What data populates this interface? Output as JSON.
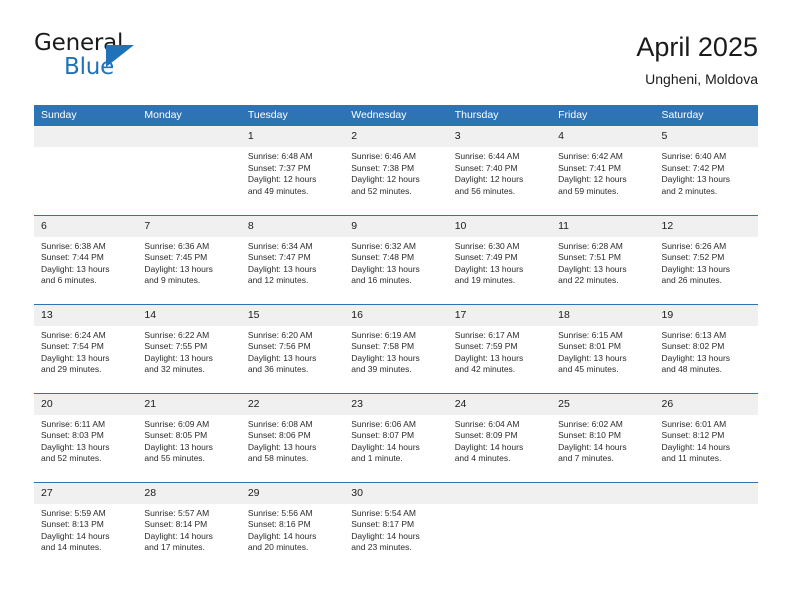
{
  "brand": {
    "line1": "General",
    "line2": "Blue",
    "logo_icon": "blue-triangle-logo",
    "accent_color": "#1f72b8"
  },
  "header": {
    "title": "April 2025",
    "subtitle": "Ungheni, Moldova"
  },
  "theme": {
    "header_bg": "#2e74b5",
    "daynum_bg": "#f0f0f0",
    "text": "#1b1b1b"
  },
  "calendar": {
    "weekday_headers": [
      "Sunday",
      "Monday",
      "Tuesday",
      "Wednesday",
      "Thursday",
      "Friday",
      "Saturday"
    ],
    "weeks": [
      [
        {
          "day": "",
          "sunrise": "",
          "sunset": "",
          "daylight_1": "",
          "daylight_2": ""
        },
        {
          "day": "",
          "sunrise": "",
          "sunset": "",
          "daylight_1": "",
          "daylight_2": ""
        },
        {
          "day": "1",
          "sunrise": "Sunrise: 6:48 AM",
          "sunset": "Sunset: 7:37 PM",
          "daylight_1": "Daylight: 12 hours",
          "daylight_2": "and 49 minutes."
        },
        {
          "day": "2",
          "sunrise": "Sunrise: 6:46 AM",
          "sunset": "Sunset: 7:38 PM",
          "daylight_1": "Daylight: 12 hours",
          "daylight_2": "and 52 minutes."
        },
        {
          "day": "3",
          "sunrise": "Sunrise: 6:44 AM",
          "sunset": "Sunset: 7:40 PM",
          "daylight_1": "Daylight: 12 hours",
          "daylight_2": "and 56 minutes."
        },
        {
          "day": "4",
          "sunrise": "Sunrise: 6:42 AM",
          "sunset": "Sunset: 7:41 PM",
          "daylight_1": "Daylight: 12 hours",
          "daylight_2": "and 59 minutes."
        },
        {
          "day": "5",
          "sunrise": "Sunrise: 6:40 AM",
          "sunset": "Sunset: 7:42 PM",
          "daylight_1": "Daylight: 13 hours",
          "daylight_2": "and 2 minutes."
        }
      ],
      [
        {
          "day": "6",
          "sunrise": "Sunrise: 6:38 AM",
          "sunset": "Sunset: 7:44 PM",
          "daylight_1": "Daylight: 13 hours",
          "daylight_2": "and 6 minutes."
        },
        {
          "day": "7",
          "sunrise": "Sunrise: 6:36 AM",
          "sunset": "Sunset: 7:45 PM",
          "daylight_1": "Daylight: 13 hours",
          "daylight_2": "and 9 minutes."
        },
        {
          "day": "8",
          "sunrise": "Sunrise: 6:34 AM",
          "sunset": "Sunset: 7:47 PM",
          "daylight_1": "Daylight: 13 hours",
          "daylight_2": "and 12 minutes."
        },
        {
          "day": "9",
          "sunrise": "Sunrise: 6:32 AM",
          "sunset": "Sunset: 7:48 PM",
          "daylight_1": "Daylight: 13 hours",
          "daylight_2": "and 16 minutes."
        },
        {
          "day": "10",
          "sunrise": "Sunrise: 6:30 AM",
          "sunset": "Sunset: 7:49 PM",
          "daylight_1": "Daylight: 13 hours",
          "daylight_2": "and 19 minutes."
        },
        {
          "day": "11",
          "sunrise": "Sunrise: 6:28 AM",
          "sunset": "Sunset: 7:51 PM",
          "daylight_1": "Daylight: 13 hours",
          "daylight_2": "and 22 minutes."
        },
        {
          "day": "12",
          "sunrise": "Sunrise: 6:26 AM",
          "sunset": "Sunset: 7:52 PM",
          "daylight_1": "Daylight: 13 hours",
          "daylight_2": "and 26 minutes."
        }
      ],
      [
        {
          "day": "13",
          "sunrise": "Sunrise: 6:24 AM",
          "sunset": "Sunset: 7:54 PM",
          "daylight_1": "Daylight: 13 hours",
          "daylight_2": "and 29 minutes."
        },
        {
          "day": "14",
          "sunrise": "Sunrise: 6:22 AM",
          "sunset": "Sunset: 7:55 PM",
          "daylight_1": "Daylight: 13 hours",
          "daylight_2": "and 32 minutes."
        },
        {
          "day": "15",
          "sunrise": "Sunrise: 6:20 AM",
          "sunset": "Sunset: 7:56 PM",
          "daylight_1": "Daylight: 13 hours",
          "daylight_2": "and 36 minutes."
        },
        {
          "day": "16",
          "sunrise": "Sunrise: 6:19 AM",
          "sunset": "Sunset: 7:58 PM",
          "daylight_1": "Daylight: 13 hours",
          "daylight_2": "and 39 minutes."
        },
        {
          "day": "17",
          "sunrise": "Sunrise: 6:17 AM",
          "sunset": "Sunset: 7:59 PM",
          "daylight_1": "Daylight: 13 hours",
          "daylight_2": "and 42 minutes."
        },
        {
          "day": "18",
          "sunrise": "Sunrise: 6:15 AM",
          "sunset": "Sunset: 8:01 PM",
          "daylight_1": "Daylight: 13 hours",
          "daylight_2": "and 45 minutes."
        },
        {
          "day": "19",
          "sunrise": "Sunrise: 6:13 AM",
          "sunset": "Sunset: 8:02 PM",
          "daylight_1": "Daylight: 13 hours",
          "daylight_2": "and 48 minutes."
        }
      ],
      [
        {
          "day": "20",
          "sunrise": "Sunrise: 6:11 AM",
          "sunset": "Sunset: 8:03 PM",
          "daylight_1": "Daylight: 13 hours",
          "daylight_2": "and 52 minutes."
        },
        {
          "day": "21",
          "sunrise": "Sunrise: 6:09 AM",
          "sunset": "Sunset: 8:05 PM",
          "daylight_1": "Daylight: 13 hours",
          "daylight_2": "and 55 minutes."
        },
        {
          "day": "22",
          "sunrise": "Sunrise: 6:08 AM",
          "sunset": "Sunset: 8:06 PM",
          "daylight_1": "Daylight: 13 hours",
          "daylight_2": "and 58 minutes."
        },
        {
          "day": "23",
          "sunrise": "Sunrise: 6:06 AM",
          "sunset": "Sunset: 8:07 PM",
          "daylight_1": "Daylight: 14 hours",
          "daylight_2": "and 1 minute."
        },
        {
          "day": "24",
          "sunrise": "Sunrise: 6:04 AM",
          "sunset": "Sunset: 8:09 PM",
          "daylight_1": "Daylight: 14 hours",
          "daylight_2": "and 4 minutes."
        },
        {
          "day": "25",
          "sunrise": "Sunrise: 6:02 AM",
          "sunset": "Sunset: 8:10 PM",
          "daylight_1": "Daylight: 14 hours",
          "daylight_2": "and 7 minutes."
        },
        {
          "day": "26",
          "sunrise": "Sunrise: 6:01 AM",
          "sunset": "Sunset: 8:12 PM",
          "daylight_1": "Daylight: 14 hours",
          "daylight_2": "and 11 minutes."
        }
      ],
      [
        {
          "day": "27",
          "sunrise": "Sunrise: 5:59 AM",
          "sunset": "Sunset: 8:13 PM",
          "daylight_1": "Daylight: 14 hours",
          "daylight_2": "and 14 minutes."
        },
        {
          "day": "28",
          "sunrise": "Sunrise: 5:57 AM",
          "sunset": "Sunset: 8:14 PM",
          "daylight_1": "Daylight: 14 hours",
          "daylight_2": "and 17 minutes."
        },
        {
          "day": "29",
          "sunrise": "Sunrise: 5:56 AM",
          "sunset": "Sunset: 8:16 PM",
          "daylight_1": "Daylight: 14 hours",
          "daylight_2": "and 20 minutes."
        },
        {
          "day": "30",
          "sunrise": "Sunrise: 5:54 AM",
          "sunset": "Sunset: 8:17 PM",
          "daylight_1": "Daylight: 14 hours",
          "daylight_2": "and 23 minutes."
        },
        {
          "day": "",
          "sunrise": "",
          "sunset": "",
          "daylight_1": "",
          "daylight_2": ""
        },
        {
          "day": "",
          "sunrise": "",
          "sunset": "",
          "daylight_1": "",
          "daylight_2": ""
        },
        {
          "day": "",
          "sunrise": "",
          "sunset": "",
          "daylight_1": "",
          "daylight_2": ""
        }
      ]
    ]
  }
}
